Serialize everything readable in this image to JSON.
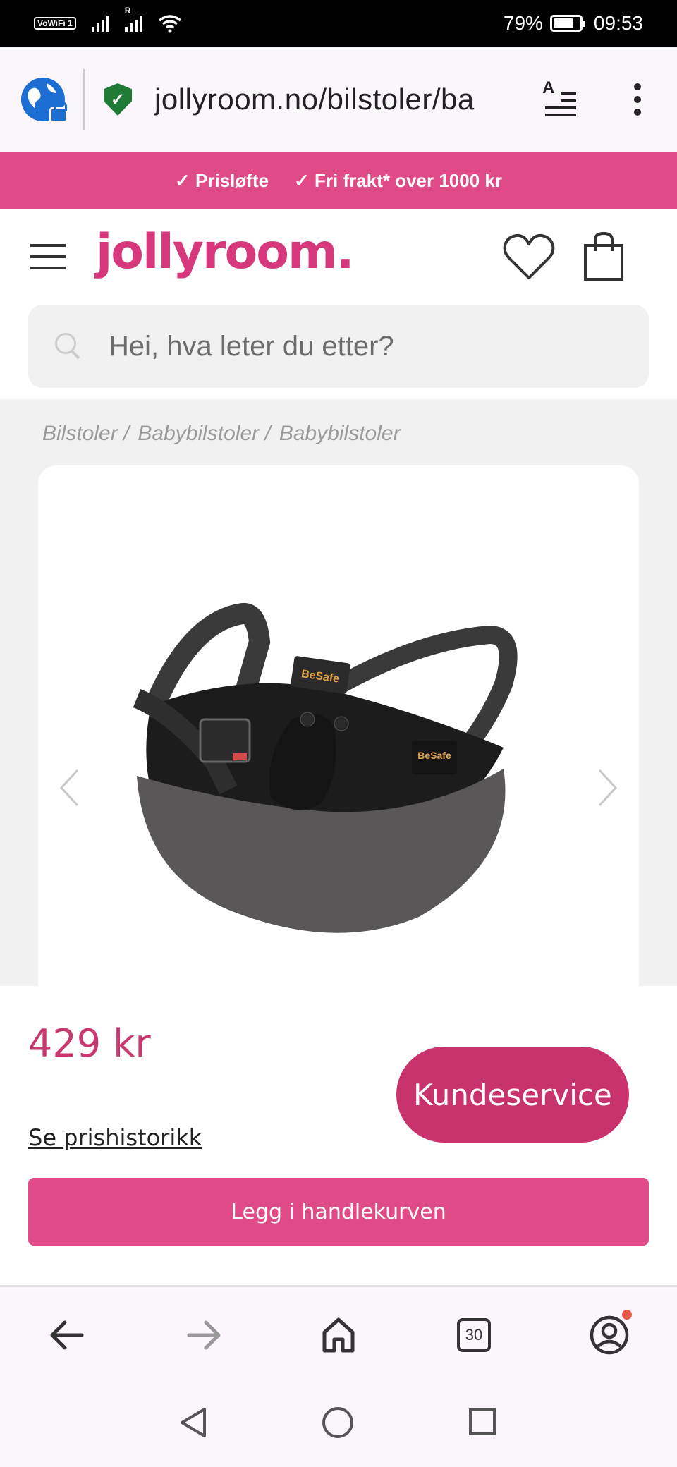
{
  "status_bar": {
    "vowifi": "VoWiFi",
    "sim1": "1",
    "roaming": "R",
    "battery": "79%",
    "battery_level": 0.79,
    "time": "09:53"
  },
  "browser": {
    "url": "jollyroom.no/bilstoler/ba",
    "icons": [
      "globe-lock-icon",
      "shield-check-icon",
      "reader-mode-icon",
      "more-vert-icon"
    ]
  },
  "promo": {
    "items": [
      "✓ Prisløfte",
      "✓ Fri frakt* over 1000 kr"
    ]
  },
  "header": {
    "logo": "jollyroom.",
    "search_placeholder": "Hei, hva leter du etter?"
  },
  "breadcrumb": [
    "Bilstoler /",
    "Babybilstoler /",
    "Babybilstoler"
  ],
  "product": {
    "image_label": "BeSafe",
    "price": "429 kr",
    "price_history": "Se prishistorikk",
    "add_to_cart": "Legg i handlekurven",
    "customer_service": "Kundeservice"
  },
  "bottom_nav": {
    "tab_count": "30"
  },
  "colors": {
    "brand_pink": "#e04a87",
    "price_pink": "#c9376f",
    "globe_blue": "#1d6ed3",
    "shield_green": "#1f7a35"
  }
}
